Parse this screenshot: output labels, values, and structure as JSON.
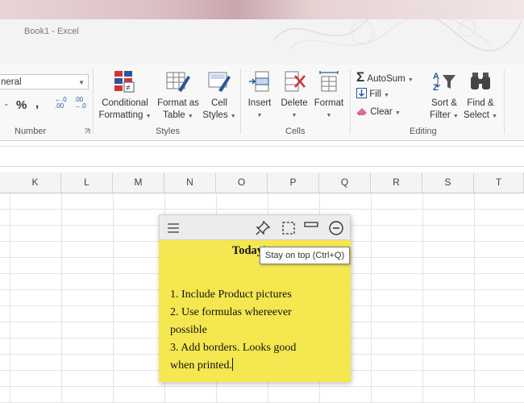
{
  "window": {
    "title": "Book1  -  Excel"
  },
  "ribbon": {
    "number_format": "neral",
    "number": {
      "percent": "%",
      "comma": ",",
      "increase_decimal_top": "←.0",
      "increase_decimal_bottom": ".00",
      "decrease_decimal_top": ".00",
      "decrease_decimal_bottom": "→.0",
      "dash": "-",
      "label": "Number"
    },
    "styles": {
      "conditional_formatting": [
        "Conditional",
        "Formatting"
      ],
      "format_as_table": [
        "Format as",
        "Table"
      ],
      "cell_styles": [
        "Cell",
        "Styles"
      ],
      "label": "Styles"
    },
    "cells": {
      "insert": "Insert",
      "delete": "Delete",
      "format": "Format",
      "label": "Cells"
    },
    "editing": {
      "autosum": "AutoSum",
      "fill": "Fill",
      "clear": "Clear",
      "sort_filter": [
        "Sort &",
        "Filter"
      ],
      "find_select": [
        "Find &",
        "Select"
      ],
      "label": "Editing"
    }
  },
  "sheet": {
    "columns": [
      "K",
      "L",
      "M",
      "N",
      "O",
      "P",
      "Q",
      "R",
      "S",
      "T"
    ]
  },
  "sticky_note": {
    "title": "Today's t",
    "lines": [
      "1. Include Product pictures",
      "2. Use formulas whereever",
      "possible",
      "3. Add borders. Looks good",
      "when printed."
    ]
  },
  "tooltip": {
    "text": "Stay on top (Ctrl+Q)"
  },
  "colors": {
    "note_yellow": "#f5e74f",
    "excel_green": "#217346",
    "accent_red": "#d13438",
    "accent_blue": "#2b579a"
  }
}
